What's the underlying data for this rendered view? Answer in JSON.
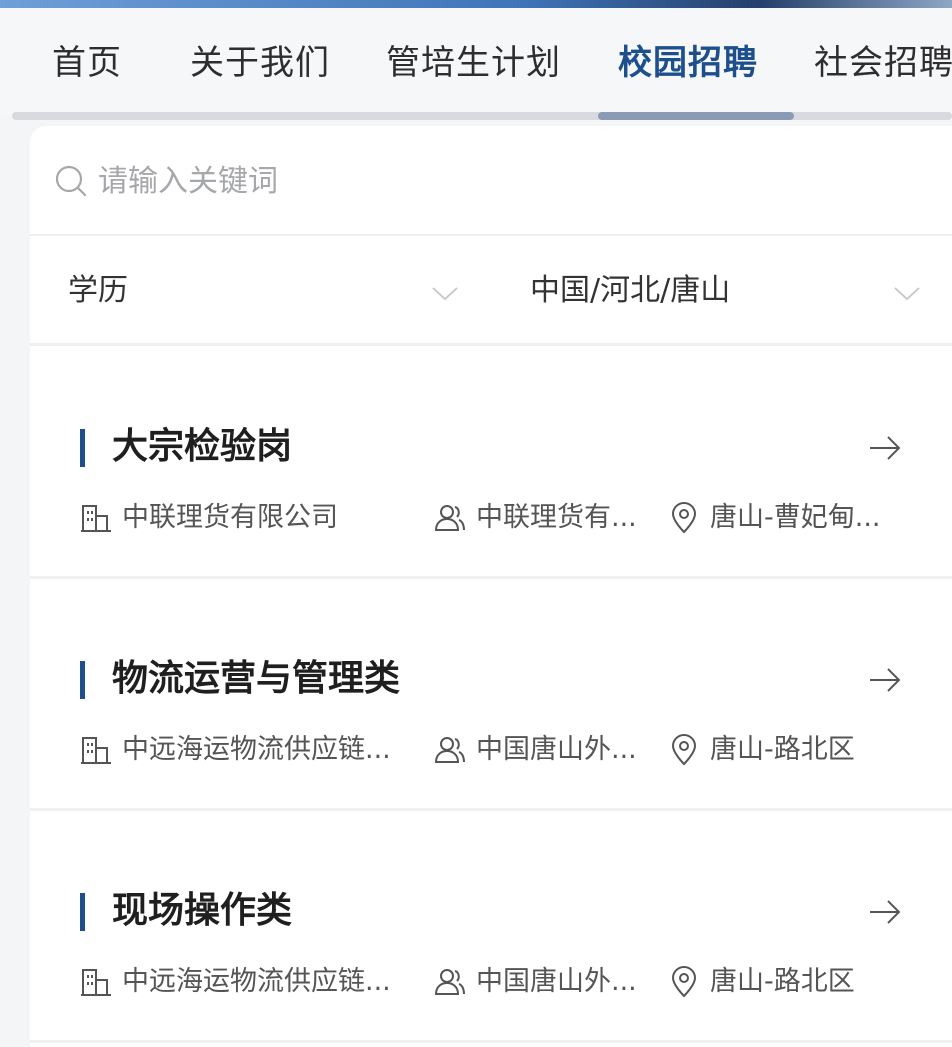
{
  "nav": {
    "tabs": [
      {
        "label": "首页",
        "active": false
      },
      {
        "label": "关于我们",
        "active": false
      },
      {
        "label": "管培生计划",
        "active": false
      },
      {
        "label": "校园招聘",
        "active": true
      },
      {
        "label": "社会招聘",
        "active": false
      }
    ]
  },
  "search": {
    "placeholder": "请输入关键词",
    "icon": "search-icon"
  },
  "filters": {
    "education": {
      "label": "学历",
      "icon": "chevron-down-icon"
    },
    "location": {
      "label": "中国/河北/唐山",
      "icon": "chevron-down-icon"
    }
  },
  "jobs": [
    {
      "title": "大宗检验岗",
      "company": "中联理货有限公司",
      "recruiter": "中联理货有...",
      "location": "唐山-曹妃甸..."
    },
    {
      "title": "物流运营与管理类",
      "company": "中远海运物流供应链...",
      "recruiter": "中国唐山外...",
      "location": "唐山-路北区"
    },
    {
      "title": "现场操作类",
      "company": "中远海运物流供应链...",
      "recruiter": "中国唐山外...",
      "location": "唐山-路北区"
    }
  ],
  "colors": {
    "accent": "#1d4f8c",
    "text": "#222222",
    "muted": "#a5a7ab",
    "background": "#f4f5f7"
  }
}
